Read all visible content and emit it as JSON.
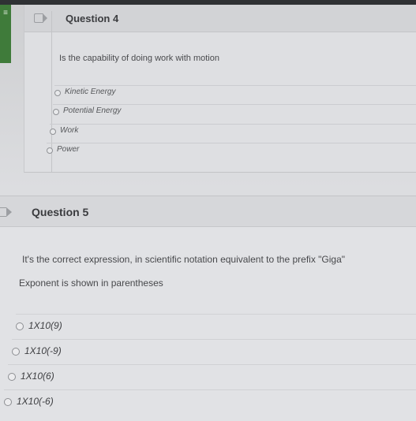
{
  "question4": {
    "title": "Question 4",
    "text": "Is the capability of doing work with motion",
    "options": [
      "Kinetic Energy",
      "Potential Energy",
      "Work",
      "Power"
    ]
  },
  "question5": {
    "title": "Question 5",
    "text": "It's the correct expression, in scientific notation equivalent to the prefix \"Giga\"",
    "note": "Exponent is shown in parentheses",
    "options": [
      "1X10(9)",
      "1X10(-9)",
      "1X10(6)",
      "1X10(-6)"
    ]
  },
  "sidebar": {
    "tab_glyph": "≡"
  },
  "colors": {
    "sidebar_green": "#3f7b3a",
    "top_bar": "#2f3134"
  }
}
